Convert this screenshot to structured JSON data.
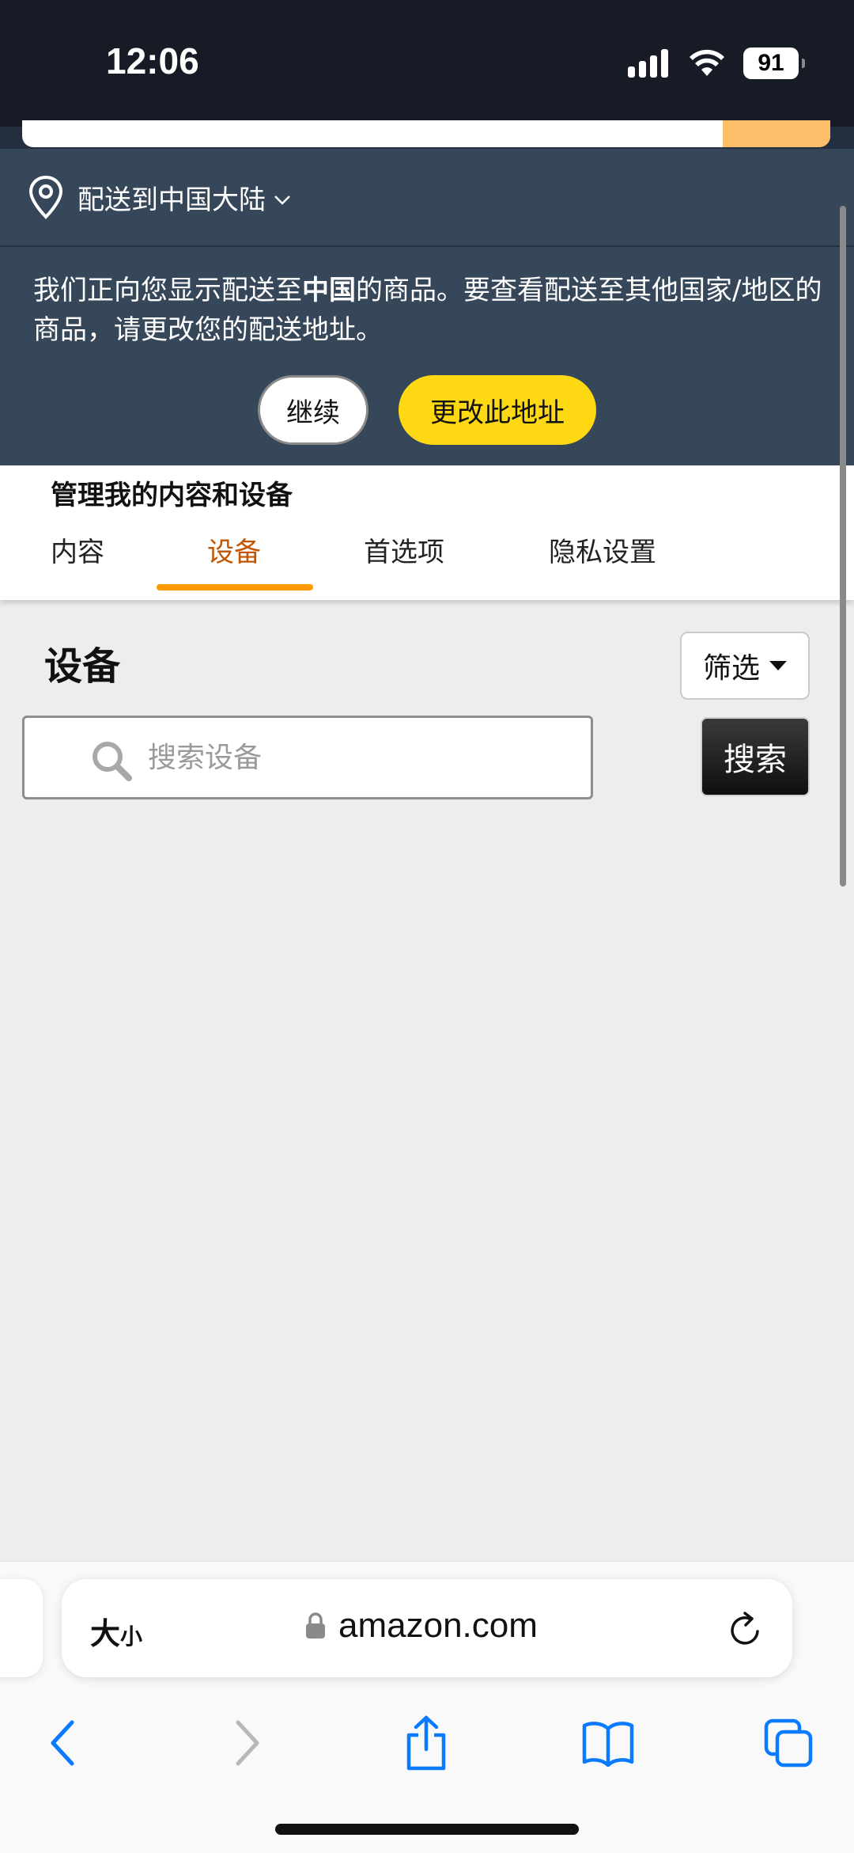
{
  "status_bar": {
    "time": "12:06",
    "battery": "91"
  },
  "delivery": {
    "label": "配送到中国大陆"
  },
  "notice": {
    "msg_before": "我们正向您显示配送至",
    "msg_bold": "中国",
    "msg_after": "的商品。要查看配送至其他国家/地区的商品，请更改您的配送地址。",
    "continue_label": "继续",
    "change_label": "更改此地址"
  },
  "content_header": {
    "title": "管理我的内容和设备",
    "tabs": [
      {
        "label": "内容"
      },
      {
        "label": "设备"
      },
      {
        "label": "首选项"
      },
      {
        "label": "隐私设置"
      }
    ]
  },
  "devices": {
    "title": "设备",
    "filter_label": "筛选",
    "search_placeholder": "搜索设备",
    "search_button": "搜索"
  },
  "safari": {
    "aa_big": "大",
    "aa_small": "小",
    "url": "amazon.com"
  },
  "colors": {
    "header_dark": "#37475a",
    "accent_yellow": "#ffd814",
    "tab_active": "#c45500",
    "tab_underline": "#ff9900",
    "ios_blue": "#0a7aff"
  },
  "icons": [
    "location-pin-icon",
    "search-icon",
    "lock-icon",
    "reload-icon",
    "back-icon",
    "forward-icon",
    "share-icon",
    "bookmarks-icon",
    "tabs-icon"
  ]
}
